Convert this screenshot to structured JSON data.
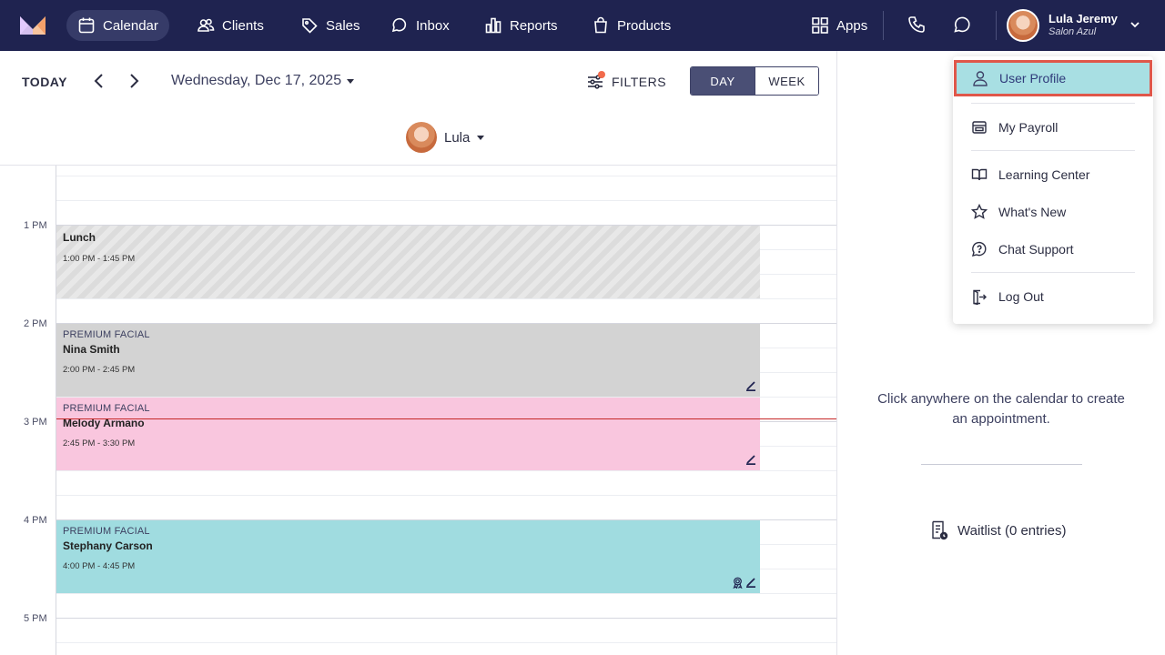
{
  "nav": {
    "items": [
      {
        "label": "Calendar",
        "icon": "calendar-icon"
      },
      {
        "label": "Clients",
        "icon": "clients-icon"
      },
      {
        "label": "Sales",
        "icon": "tag-icon"
      },
      {
        "label": "Inbox",
        "icon": "chat-bubble-icon"
      },
      {
        "label": "Reports",
        "icon": "bar-chart-icon"
      },
      {
        "label": "Products",
        "icon": "shopping-bag-icon"
      }
    ],
    "apps_label": "Apps",
    "user_name": "Lula Jeremy",
    "user_salon": "Salon Azul"
  },
  "toolbar": {
    "today_label": "TODAY",
    "date": "Wednesday, Dec 17, 2025",
    "filters_label": "FILTERS",
    "view_day": "DAY",
    "view_week": "WEEK",
    "staff_name": "Lula"
  },
  "calendar": {
    "hours": [
      "1 PM",
      "2 PM",
      "3 PM",
      "4 PM",
      "5 PM"
    ],
    "appointments": [
      {
        "service": "",
        "client": "Lunch",
        "time": "1:00 PM - 1:45 PM",
        "color": "#dcdcdc"
      },
      {
        "service": "PREMIUM FACIAL",
        "client": "Nina Smith",
        "time": "2:00 PM - 2:45 PM",
        "color": "#d3d3d3"
      },
      {
        "service": "PREMIUM FACIAL",
        "client": "Melody Armano",
        "time": "2:45 PM - 3:30 PM",
        "color": "#f9c6de"
      },
      {
        "service": "PREMIUM FACIAL",
        "client": "Stephany Carson",
        "time": "4:00 PM - 4:45 PM",
        "color": "#a0dce0"
      }
    ]
  },
  "panel": {
    "hint": "Click anywhere on the calendar to create an appointment.",
    "waitlist": "Waitlist (0 entries)"
  },
  "menu": {
    "items": [
      {
        "label": "User Profile",
        "icon": "user-icon"
      },
      {
        "label": "My Payroll",
        "icon": "payroll-icon"
      },
      {
        "label": "Learning Center",
        "icon": "book-icon"
      },
      {
        "label": "What's New",
        "icon": "star-icon"
      },
      {
        "label": "Chat Support",
        "icon": "chat-support-icon"
      },
      {
        "label": "Log Out",
        "icon": "logout-icon"
      }
    ]
  },
  "colors": {
    "nav_bg": "#1f2350",
    "highlight_bg": "#a8dfe3",
    "highlight_border": "#e0574a",
    "now_line": "#c62828"
  }
}
